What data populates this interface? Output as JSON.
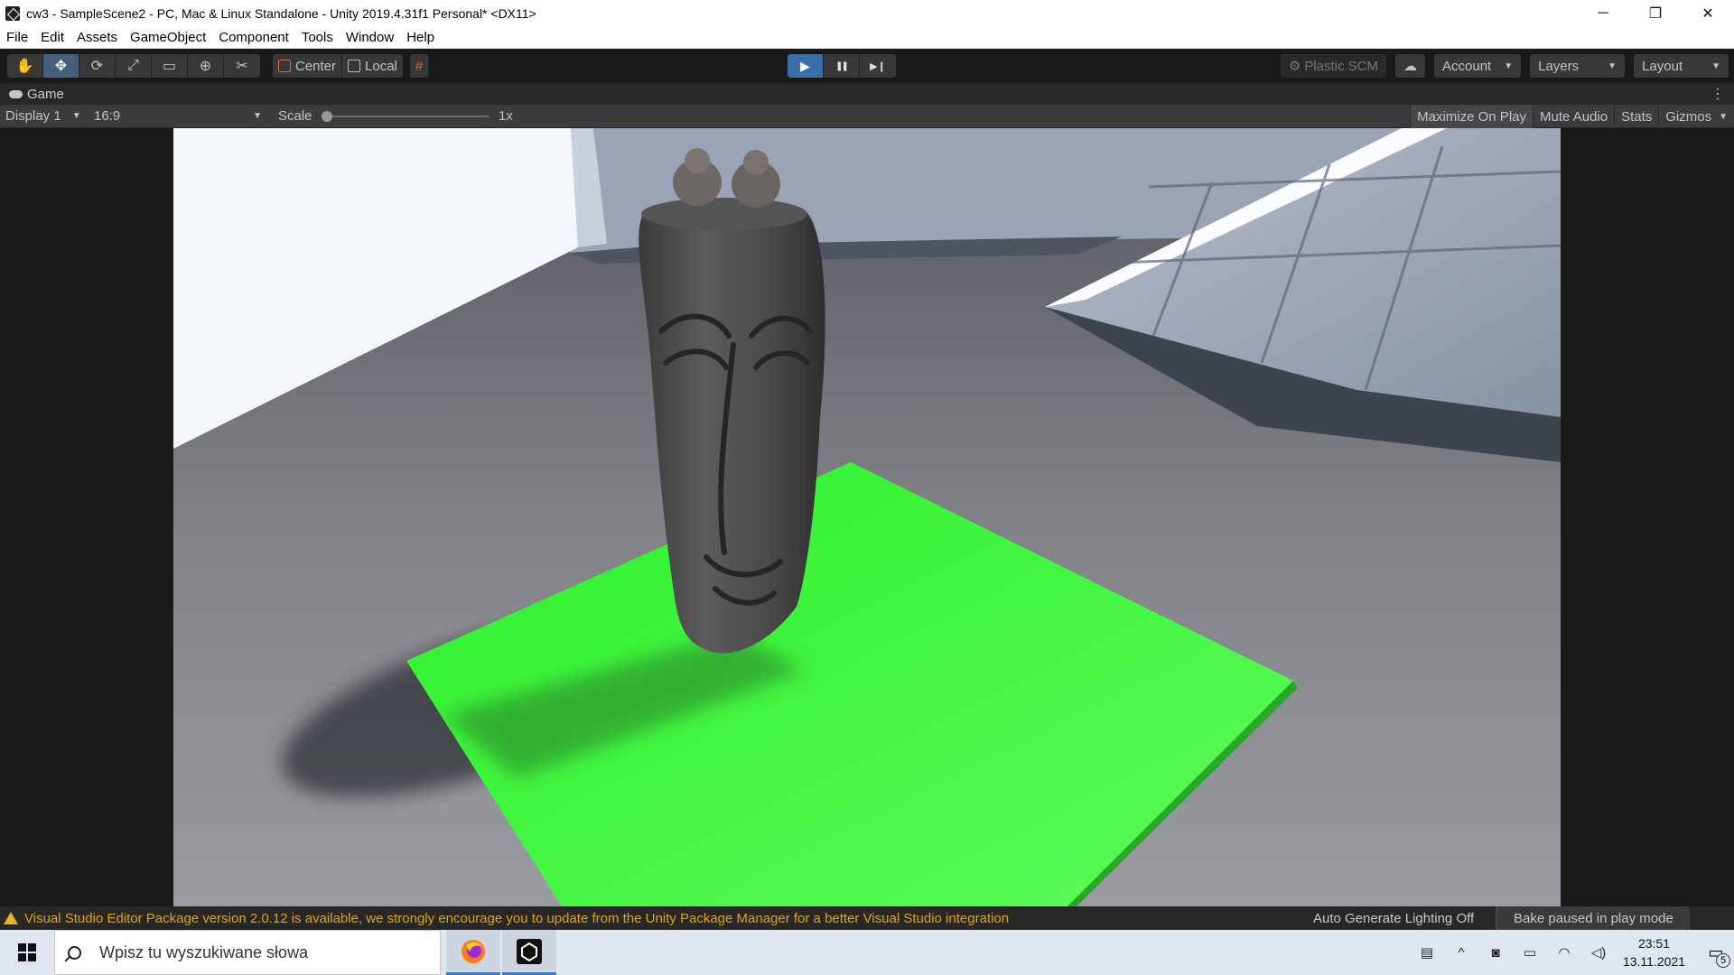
{
  "window": {
    "title": "cw3 - SampleScene2 - PC, Mac & Linux Standalone - Unity 2019.4.31f1 Personal* <DX11>",
    "controls": [
      "─",
      "❐",
      "✕"
    ]
  },
  "menu": [
    "File",
    "Edit",
    "Assets",
    "GameObject",
    "Component",
    "Tools",
    "Window",
    "Help"
  ],
  "toolbar": {
    "tools": [
      {
        "name": "hand-tool-icon",
        "glyph": "✋"
      },
      {
        "name": "move-tool-icon",
        "glyph": "✥"
      },
      {
        "name": "rotate-tool-icon",
        "glyph": "⟳"
      },
      {
        "name": "scale-tool-icon",
        "glyph": "⤢"
      },
      {
        "name": "rect-tool-icon",
        "glyph": "▭"
      },
      {
        "name": "transform-tool-icon",
        "glyph": "⊕"
      },
      {
        "name": "custom-tool-icon",
        "glyph": "✂"
      }
    ],
    "pivot_label": "Center",
    "space_label": "Local",
    "grid_glyph": "#",
    "play_glyph": "▶",
    "pause_glyph": "❚❚",
    "step_glyph": "▶❙",
    "plastic_scm": "Plastic SCM",
    "cloud_glyph": "☁",
    "account": "Account",
    "layers": "Layers",
    "layout": "Layout"
  },
  "game_tab": {
    "title": "Game",
    "kebab": "⋮",
    "display": "Display 1",
    "aspect": "16:9",
    "scale_label": "Scale",
    "scale_value": "1x",
    "scale_fraction": 0.0,
    "maximize": "Maximize On Play",
    "mute": "Mute Audio",
    "stats": "Stats",
    "gizmos": "Gizmos"
  },
  "status": {
    "warning": "Visual Studio Editor Package version 2.0.12 is available, we strongly encourage you to update from the Unity Package Manager for a better Visual Studio integration",
    "lighting": "Auto Generate Lighting Off",
    "bake": "Bake paused in play mode",
    "warning_color": "#e0a41c"
  },
  "taskbar": {
    "search_placeholder": "Wpisz tu wyszukiwane słowa",
    "time": "23:51",
    "date": "13.11.2021",
    "notifications": "5",
    "apps": [
      "firefox-icon",
      "unity-icon"
    ]
  },
  "scene_colors": {
    "floor": "#7f8084",
    "green_plane": "#3bf03a",
    "wall_white": "#f4f6fa",
    "wall_blue": "#98a4b8",
    "statue": "#4a4a4a"
  }
}
